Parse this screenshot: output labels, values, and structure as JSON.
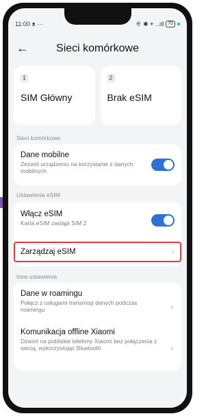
{
  "status_bar": {
    "time": "11:00",
    "left_icons": "ᴥ ···",
    "signal": "⚟ ✱ ⌖ ‥ıll",
    "battery": "70"
  },
  "header": {
    "title": "Sieci komórkowe"
  },
  "sim_cards": [
    {
      "number": "1",
      "name": "SIM Główny"
    },
    {
      "number": "2",
      "name": "Brak eSIM"
    }
  ],
  "sections": {
    "mobile": "Sieci komórkowe",
    "esim": "Ustawienia eSIM",
    "other": "Inne ustawienia"
  },
  "mobile_data": {
    "title": "Dane mobilne",
    "desc": "Zezwól urządzeniu na korzystanie z danych mobilnych",
    "enabled": true
  },
  "enable_esim": {
    "title": "Włącz eSIM",
    "desc": "Karta eSIM zastąpi SIM 2",
    "enabled": true
  },
  "manage_esim": {
    "title": "Zarządzaj eSIM"
  },
  "roaming": {
    "title": "Dane w roamingu",
    "desc": "Połącz z usługami transmisji danych podczas roamingu"
  },
  "offline": {
    "title": "Komunikacja offline Xiaomi",
    "desc": "Dzwoń na pobliskie telefony Xiaomi bez połączenia z siecią, wykorzystując Bluetooth"
  }
}
